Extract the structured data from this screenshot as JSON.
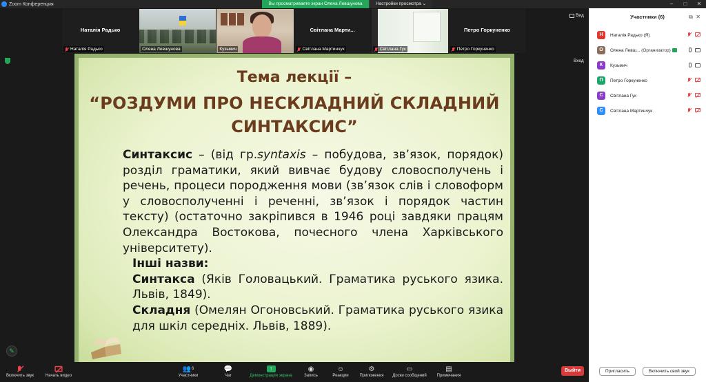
{
  "window": {
    "title": "Zoom Конференция",
    "controls": [
      "–",
      "□",
      "✕"
    ]
  },
  "share_banner": {
    "viewing_text": "Вы просматриваете экран Олена Левшунова",
    "view_options": "Настройки просмотра ⌄"
  },
  "thumbnails": [
    {
      "center_name": "Наталія Радько",
      "label": "Наталія Радько",
      "muted": true
    },
    {
      "center_name": "",
      "label": "Олена Левшунова",
      "muted": false
    },
    {
      "center_name": "",
      "label": "Кузьмич",
      "muted": false
    },
    {
      "center_name": "Світлана  Марти...",
      "label": "Світлана Мартинчук",
      "muted": true
    },
    {
      "center_name": "",
      "label": "Світлана Гук",
      "muted": true
    },
    {
      "center_name": "Петро  Горкуненко",
      "label": "Петро Горкуненко",
      "muted": true
    }
  ],
  "side_labels": {
    "view_top": "Вид",
    "view_mid": "Вход"
  },
  "slide": {
    "title_line1": "Тема лекції –",
    "title_line2": "“РОЗДУМИ ПРО НЕСКЛАДНИЙ СКЛАДНИЙ",
    "title_line3": "СИНТАКСИС”",
    "term": "Синтаксис",
    "def_part1": " – (від гр.",
    "def_italic": "syntaxis",
    "def_part2": " – побудова, зв’язок, порядок) розділ граматики, який вивчає будову словосполучень і речень, процеси породження мови (зв’язок слів і словоформ у словосполученні і реченні, зв’язок і порядок частин тексту) (остаточно закріпився в 1946 році завдяки працям Олександра Востокова, почесного члена Харківського університету).",
    "other_names": "Інші назви:",
    "syntaksa_term": "Синтакса",
    "syntaksa_src": " (Яків Головацький. Граматика руського язика. Львів, 1849).",
    "skladnia_term": "Складня",
    "skladnia_src": " (Омелян Огоновський. Граматика руського язика для шкіл середніх. Львів, 1889)."
  },
  "participants_panel": {
    "title": "Участники (6)",
    "participants": [
      {
        "initial": "Н",
        "color": "#e0382f",
        "name": "Наталія Радько (Я)",
        "role": "",
        "mic": "muted",
        "video": "off"
      },
      {
        "initial": "О",
        "color": "#8a6d5a",
        "name": "Олена Левш...",
        "role": " (Организатор)",
        "mic": "on",
        "video": "on"
      },
      {
        "initial": "К",
        "color": "#8b3cc9",
        "name": "Кузьмич",
        "role": "",
        "mic": "on",
        "video": "on"
      },
      {
        "initial": "П",
        "color": "#1ba86b",
        "name": "Петро Горкуненко",
        "role": "",
        "mic": "muted",
        "video": "off"
      },
      {
        "initial": "С",
        "color": "#8b3cc9",
        "name": "Світлана Гук",
        "role": "",
        "mic": "muted",
        "video": "off"
      },
      {
        "initial": "С",
        "color": "#2d8cff",
        "name": "Світлана Мартинчук",
        "role": "",
        "mic": "muted",
        "video": "off"
      }
    ],
    "invite_button": "Пригласить",
    "unmute_button": "Включить свой звук"
  },
  "toolbar": {
    "unmute": "Включить звук",
    "start_video": "Начать видео",
    "participants": "Участники",
    "participants_count": "6",
    "chat": "Чат",
    "share_screen": "Демонстрация экрана",
    "record": "Запись",
    "reactions": "Реакции",
    "apps": "Приложения",
    "whiteboards": "Доски сообщений",
    "notes": "Примечания",
    "leave": "Выйти"
  }
}
